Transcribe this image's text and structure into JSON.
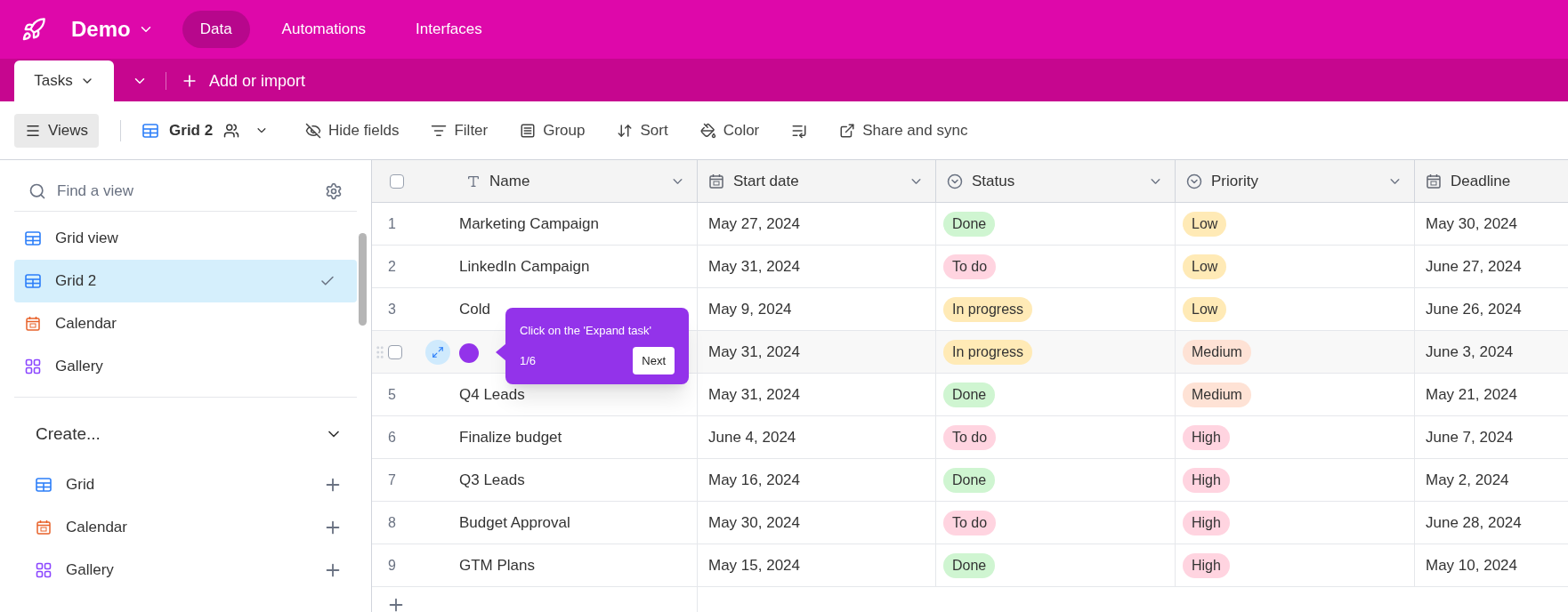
{
  "app": {
    "name": "Demo",
    "nav": [
      {
        "label": "Data",
        "selected": true
      },
      {
        "label": "Automations",
        "selected": false
      },
      {
        "label": "Interfaces",
        "selected": false
      }
    ]
  },
  "tabs": {
    "items": [
      {
        "label": "Tasks",
        "selected": true
      }
    ],
    "add": "Add or import"
  },
  "toolbar": {
    "views": "Views",
    "view_name": "Grid 2",
    "items": [
      {
        "kind": "hide",
        "label": "Hide fields"
      },
      {
        "kind": "filter",
        "label": "Filter"
      },
      {
        "kind": "group",
        "label": "Group"
      },
      {
        "kind": "sort",
        "label": "Sort"
      },
      {
        "kind": "color",
        "label": "Color"
      },
      {
        "kind": "rowheight"
      },
      {
        "kind": "share",
        "label": "Share and sync"
      }
    ]
  },
  "sidebar": {
    "search": {
      "placeholder": "Find a view"
    },
    "views": [
      {
        "kind": "grid",
        "label": "Grid view",
        "selected": false
      },
      {
        "kind": "grid",
        "label": "Grid 2",
        "selected": true
      },
      {
        "kind": "calendar",
        "label": "Calendar",
        "selected": false
      },
      {
        "kind": "gallery",
        "label": "Gallery",
        "selected": false
      }
    ],
    "create": {
      "title": "Create...",
      "items": [
        {
          "kind": "grid",
          "label": "Grid"
        },
        {
          "kind": "calendar",
          "label": "Calendar"
        },
        {
          "kind": "gallery",
          "label": "Gallery"
        }
      ]
    }
  },
  "table": {
    "select_all": {
      "checked": false
    },
    "columns": [
      {
        "kind": "text",
        "label": "Name"
      },
      {
        "kind": "date",
        "label": "Start date"
      },
      {
        "kind": "select",
        "label": "Status"
      },
      {
        "kind": "select",
        "label": "Priority"
      },
      {
        "kind": "date",
        "label": "Deadline"
      }
    ],
    "rows": [
      {
        "number": "1",
        "hovered": false,
        "name": "Marketing Campaign",
        "start": "May 27, 2024",
        "status": {
          "label": "Done",
          "color": "#cff5d1"
        },
        "priority": {
          "label": "Low",
          "color": "#ffeab6"
        },
        "deadline": "May 30, 2024"
      },
      {
        "number": "2",
        "hovered": false,
        "name": "LinkedIn Campaign",
        "start": "May 31, 2024",
        "status": {
          "label": "To do",
          "color": "#ffd4e0"
        },
        "priority": {
          "label": "Low",
          "color": "#ffeab6"
        },
        "deadline": "June 27, 2024"
      },
      {
        "number": "3",
        "hovered": false,
        "name": "Cold",
        "start": "May 9, 2024",
        "status": {
          "label": "In progress",
          "color": "#ffeab6"
        },
        "priority": {
          "label": "Low",
          "color": "#ffeab6"
        },
        "deadline": "June 26, 2024"
      },
      {
        "hovered": true,
        "checked": false,
        "start": "May 31, 2024",
        "status": {
          "label": "In progress",
          "color": "#ffeab6"
        },
        "priority": {
          "label": "Medium",
          "color": "#fee2d5"
        },
        "deadline": "June 3, 2024"
      },
      {
        "number": "5",
        "hovered": false,
        "name": "Q4 Leads",
        "start": "May 31, 2024",
        "status": {
          "label": "Done",
          "color": "#cff5d1"
        },
        "priority": {
          "label": "Medium",
          "color": "#fee2d5"
        },
        "deadline": "May 21, 2024"
      },
      {
        "number": "6",
        "hovered": false,
        "name": "Finalize budget",
        "start": "June 4, 2024",
        "status": {
          "label": "To do",
          "color": "#ffd4e0"
        },
        "priority": {
          "label": "High",
          "color": "#ffd4e0"
        },
        "deadline": "June 7, 2024"
      },
      {
        "number": "7",
        "hovered": false,
        "name": "Q3 Leads",
        "start": "May 16, 2024",
        "status": {
          "label": "Done",
          "color": "#cff5d1"
        },
        "priority": {
          "label": "High",
          "color": "#ffd4e0"
        },
        "deadline": "May 2, 2024"
      },
      {
        "number": "8",
        "hovered": false,
        "name": "Budget Approval",
        "start": "May 30, 2024",
        "status": {
          "label": "To do",
          "color": "#ffd4e0"
        },
        "priority": {
          "label": "High",
          "color": "#ffd4e0"
        },
        "deadline": "June 28, 2024"
      },
      {
        "number": "9",
        "hovered": false,
        "name": "GTM Plans",
        "start": "May 15, 2024",
        "status": {
          "label": "Done",
          "color": "#cff5d1"
        },
        "priority": {
          "label": "High",
          "color": "#ffd4e0"
        },
        "deadline": "May 10, 2024"
      }
    ]
  },
  "tooltip": {
    "text": "Click on the 'Expand task'",
    "step": "1/6",
    "button": "Next"
  }
}
